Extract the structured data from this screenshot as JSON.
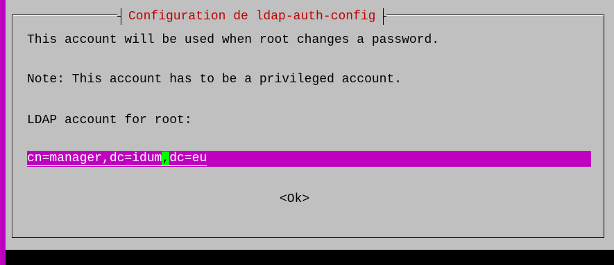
{
  "dialog": {
    "title": "Configuration de ldap-auth-config",
    "lines": [
      "This account will be used when root changes a password.",
      "Note: This account has to be a privileged account.",
      "LDAP account for root:"
    ],
    "input": {
      "value_before_cursor": "cn=manager,dc=idum",
      "cursor_char": ",",
      "value_after_cursor": "dc=eu"
    },
    "ok_button": "<Ok>"
  },
  "colors": {
    "background": "#c0c0c0",
    "accent_magenta": "#c000c0",
    "title_red": "#c00000",
    "cursor_green": "#00ff00",
    "terminal_black": "#000000"
  }
}
